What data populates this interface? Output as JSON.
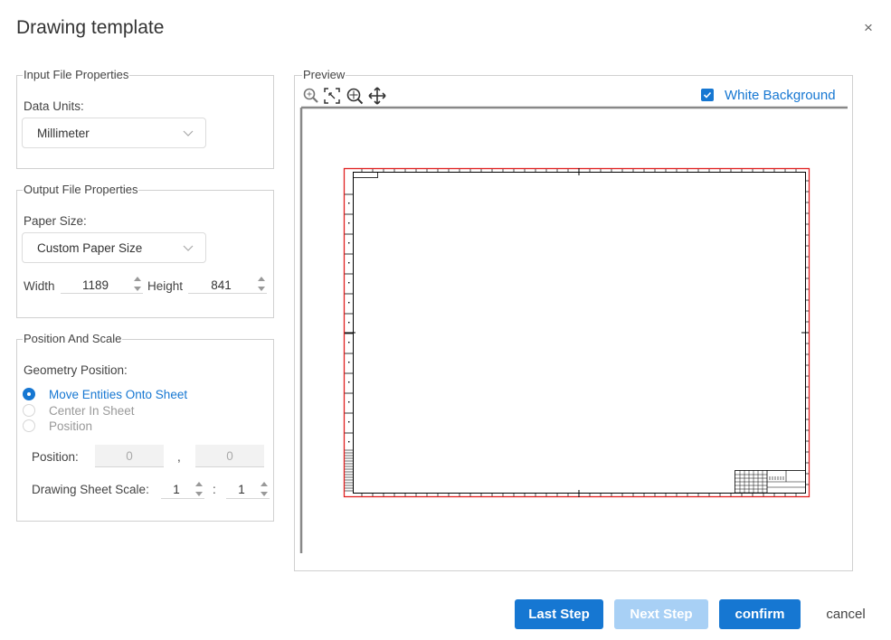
{
  "dialog": {
    "title": "Drawing template",
    "close_glyph": "×"
  },
  "input_props": {
    "legend": "Input File Properties",
    "data_units_label": "Data Units:",
    "data_units_value": "Millimeter"
  },
  "output_props": {
    "legend": "Output File Properties",
    "paper_size_label": "Paper Size:",
    "paper_size_value": "Custom Paper Size",
    "width_label": "Width",
    "width_value": "1189",
    "height_label": "Height",
    "height_value": "841"
  },
  "position_scale": {
    "legend": "Position And Scale",
    "geometry_label": "Geometry Position:",
    "options": [
      {
        "label": "Move Entities Onto Sheet",
        "selected": true
      },
      {
        "label": "Center In Sheet",
        "selected": false
      },
      {
        "label": "Position",
        "selected": false
      }
    ],
    "position_label": "Position:",
    "position_x": "0",
    "position_sep": ",",
    "position_y": "0",
    "scale_label": "Drawing Sheet Scale:",
    "scale_left": "1",
    "scale_sep": ":",
    "scale_right": "1"
  },
  "preview": {
    "legend": "Preview",
    "tools": [
      "zoom-icon",
      "zoom-window-icon",
      "zoom-extents-icon",
      "pan-icon"
    ],
    "white_background_label": "White Background",
    "white_background_checked": true,
    "colors": {
      "border": "#e02020",
      "lines": "#000000",
      "accent": "#1677d2"
    }
  },
  "footer": {
    "last_step": "Last Step",
    "next_step": "Next Step",
    "confirm": "confirm",
    "cancel": "cancel"
  }
}
